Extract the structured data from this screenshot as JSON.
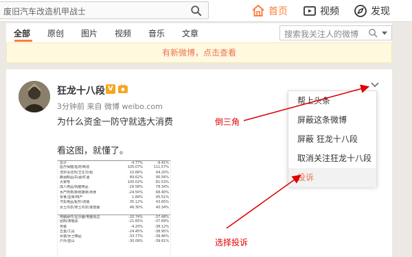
{
  "topbar": {
    "search_text": "废旧汽车改造机甲战士",
    "nav": [
      {
        "label": "首页",
        "icon": "home-icon",
        "active": true
      },
      {
        "label": "视频",
        "icon": "video-icon"
      },
      {
        "label": "发现",
        "icon": "discover-icon"
      }
    ]
  },
  "filter": {
    "tabs": [
      "全部",
      "原创",
      "图片",
      "视频",
      "音乐",
      "文章"
    ],
    "active_tab": "全部",
    "search_placeholder": "搜索我关注人的微博"
  },
  "notice": "有新微博，点击查看",
  "post": {
    "username": "狂龙十八段",
    "badge_v": "V",
    "meta": "3分钟前 来自 微博 weibo.com",
    "line1": "为什么资金一防守就选大消费",
    "line2": "看这图，就懂了。",
    "table_rows": [
      [
        "总计",
        "-4.77%",
        "-9.41%"
      ],
      [
        "医疗保健/医药/制造",
        "105.07%",
        "111.57%"
      ],
      [
        "洗护清洁剂/卫生巾/纸",
        "10.66%",
        "94.20%"
      ],
      [
        "酿酒制品/白酒/红酒",
        "89.62%",
        "90.56%"
      ],
      [
        "大家电",
        "100.02%",
        "81.53%"
      ],
      [
        "成人用品/情趣用品",
        "-16.58%",
        "78.34%"
      ],
      [
        "水产肉类/新鲜蔬果/熟食",
        "-24.50%",
        "68.40%"
      ],
      [
        "零食/坚果/特产",
        "1.89%",
        "45.51%"
      ],
      [
        "汽车用品/配件/改装",
        "35.12%",
        "43.65%"
      ],
      [
        "女士内衣/男士内衣/家居服",
        "46.30%",
        "40.34%"
      ],
      [
        "电脑硬件/显示器/电脑周边",
        "-20.74%",
        "-37.48%"
      ],
      [
        "团购/演唱会",
        "-21.65%",
        "-37.69%"
      ],
      [
        "男装",
        "-4.20%",
        "-38.12%"
      ],
      [
        "五金/工具",
        "-24.45%",
        "-38.95%"
      ],
      [
        "女装/女士精品",
        "-33.77%",
        "-39.46%"
      ],
      [
        "户外/登山",
        "-30.09%",
        "-39.61%"
      ]
    ]
  },
  "menu": {
    "items": [
      "帮上头条",
      "屏蔽这条微博",
      "屏蔽 狂龙十八段",
      "取消关注狂龙十八段",
      "投诉"
    ],
    "highlighted": "投诉"
  },
  "annotations": {
    "arrow1_label": "倒三角",
    "arrow2_label": "选择投诉",
    "color": "#e00000"
  }
}
